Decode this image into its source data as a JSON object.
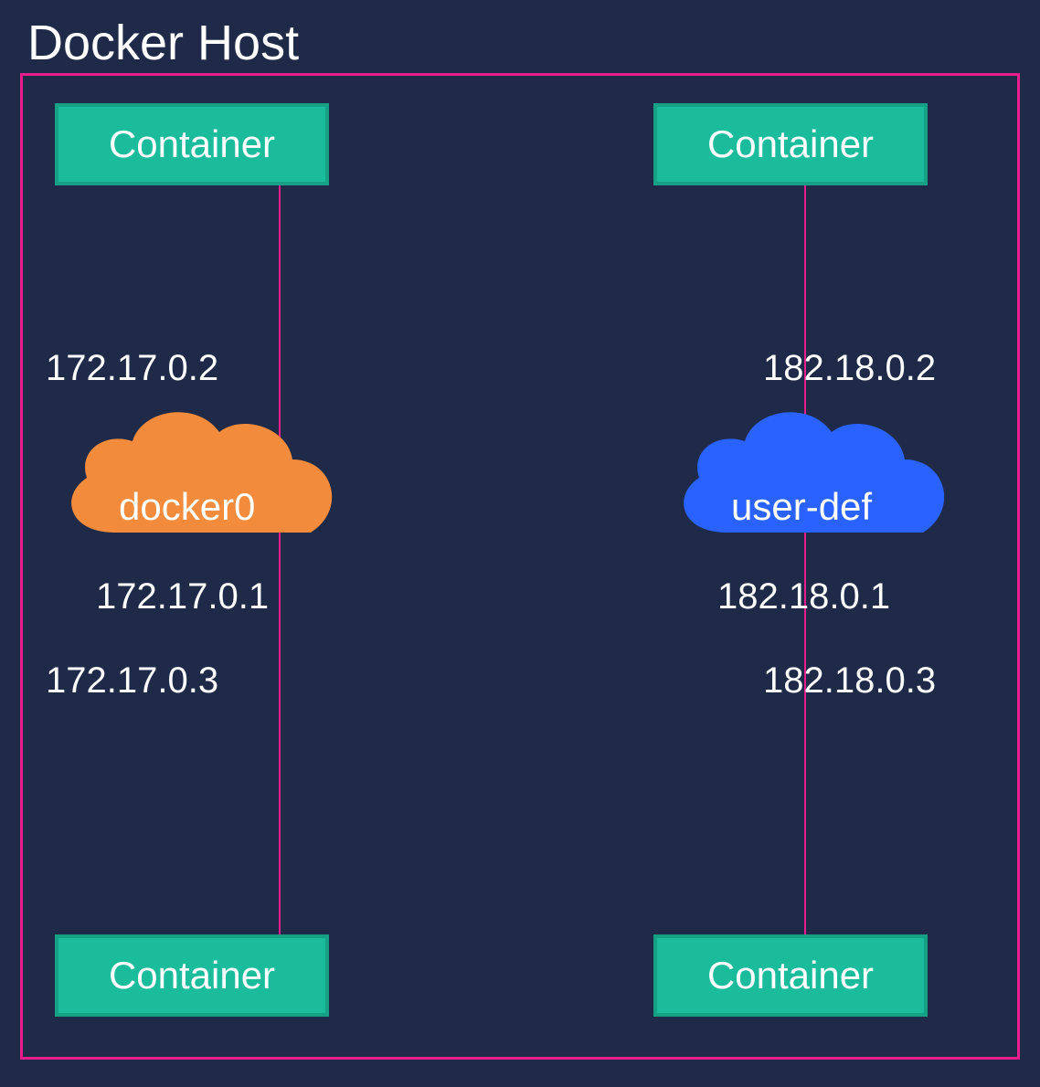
{
  "title": "Docker Host",
  "containers": {
    "top_left": "Container",
    "top_right": "Container",
    "bottom_left": "Container",
    "bottom_right": "Container"
  },
  "networks": {
    "left": {
      "name": "docker0",
      "gateway_ip": "172.17.0.1",
      "container_top_ip": "172.17.0.2",
      "container_bottom_ip": "172.17.0.3",
      "color": "#f28b3b"
    },
    "right": {
      "name": "user-def",
      "gateway_ip": "182.18.0.1",
      "container_top_ip": "182.18.0.2",
      "container_bottom_ip": "182.18.0.3",
      "color": "#2962ff"
    }
  }
}
